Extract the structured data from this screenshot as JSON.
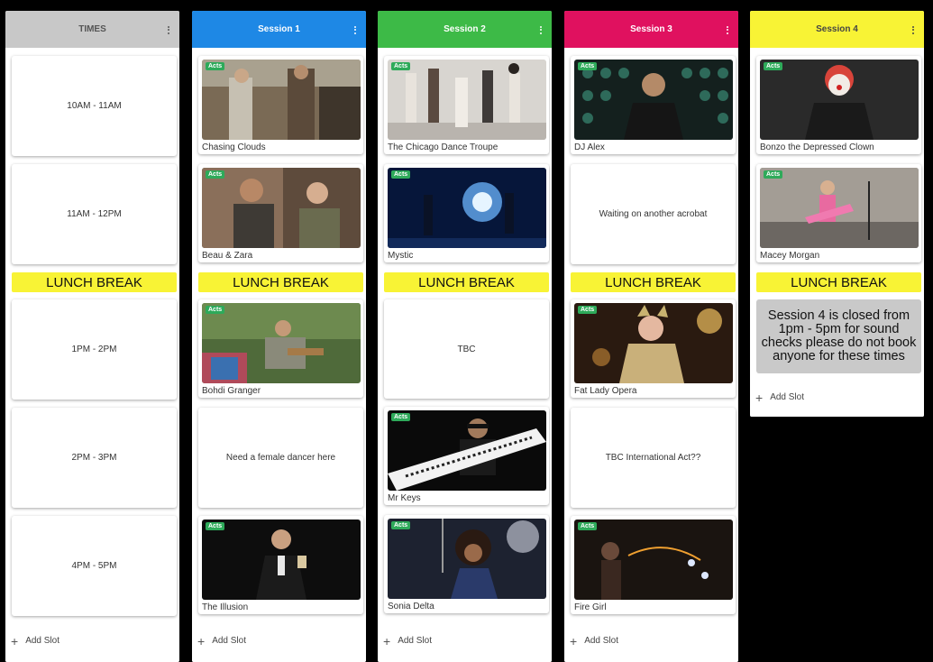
{
  "columns": [
    {
      "title": "TIMES",
      "color": "#c8c8c8",
      "text_color": "#555555"
    },
    {
      "title": "Session 1",
      "color": "#1e88e5",
      "text_color": "#ffffff"
    },
    {
      "title": "Session 2",
      "color": "#3dba47",
      "text_color": "#ffffff"
    },
    {
      "title": "Session 3",
      "color": "#e0115f",
      "text_color": "#ffffff"
    },
    {
      "title": "Session 4",
      "color": "#f8f335",
      "text_color": "#444444"
    }
  ],
  "times": [
    "10AM - 11AM",
    "11AM - 12PM",
    "1PM - 2PM",
    "2PM - 3PM",
    "4PM - 5PM"
  ],
  "lunch_label": "LUNCH BREAK",
  "tag_label": "Acts",
  "add_slot_label": "Add Slot",
  "session1": {
    "acts": [
      "Chasing Clouds",
      "Beau & Zara",
      "Bohdi Granger",
      "The Illusion"
    ],
    "note": "Need a female dancer here"
  },
  "session2": {
    "acts": [
      "The Chicago Dance Troupe",
      "Mystic",
      "Mr Keys",
      "Sonia Delta"
    ],
    "note": "TBC"
  },
  "session3": {
    "acts": [
      "DJ Alex",
      "Fat Lady Opera",
      "Fire Girl"
    ],
    "notes": [
      "Waiting on another acrobat",
      "TBC International Act??"
    ]
  },
  "session4": {
    "acts": [
      "Bonzo the Depressed Clown",
      "Macey Morgan"
    ],
    "closed_note": "Session 4 is closed from 1pm - 5pm for sound checks please do not book anyone for these times"
  }
}
